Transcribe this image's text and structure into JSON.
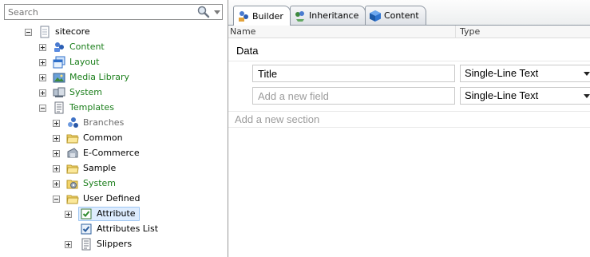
{
  "search": {
    "placeholder": "Search"
  },
  "tree": {
    "root": "sitecore",
    "items": {
      "content": "Content",
      "layout": "Layout",
      "media_library": "Media Library",
      "system": "System",
      "templates": "Templates",
      "branches": "Branches",
      "common": "Common",
      "ecommerce": "E-Commerce",
      "sample": "Sample",
      "templates_system": "System",
      "user_defined": "User Defined",
      "attribute": "Attribute",
      "attributes_list": "Attributes List",
      "slippers": "Slippers"
    }
  },
  "tabs": {
    "builder": "Builder",
    "inheritance": "Inheritance",
    "content": "Content"
  },
  "columns": {
    "name": "Name",
    "type": "Type"
  },
  "section": {
    "title": "Data",
    "fields": [
      {
        "name": "Title",
        "type": "Single-Line Text"
      }
    ],
    "new_field_placeholder": "Add a new field",
    "new_field_type": "Single-Line Text"
  },
  "new_section_placeholder": "Add a new section",
  "colors": {
    "green_label": "#1a7e1a",
    "gray_label": "#6a6a6a",
    "selection_bg": "#ddecfe",
    "tab_border": "#8d96a1"
  }
}
